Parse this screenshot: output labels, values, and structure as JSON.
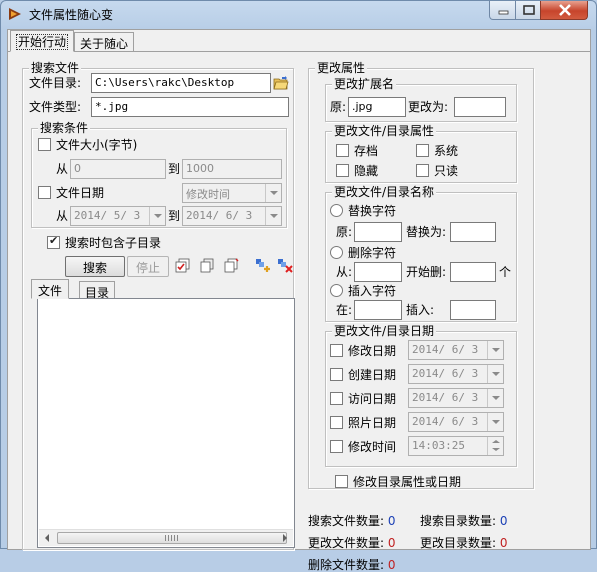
{
  "window": {
    "title": "文件属性随心变"
  },
  "tabs": [
    "开始行动",
    "关于随心"
  ],
  "search": {
    "group_title": "搜索文件",
    "dir_label": "文件目录:",
    "dir_value": "C:\\Users\\rakc\\Desktop",
    "type_label": "文件类型:",
    "type_value": "*.jpg",
    "conditions": {
      "title": "搜索条件",
      "size_label": "文件大小(字节)",
      "size_checked": false,
      "from_label": "从",
      "to_label": "到",
      "size_from": "0",
      "size_to": "1000",
      "date_label": "文件日期",
      "date_checked": false,
      "date_type": "修改时间",
      "date_from": "2014/ 5/ 3",
      "date_to": "2014/ 6/ 3"
    },
    "subdir_label": "搜索时包含子目录",
    "subdir_checked": true,
    "search_button": "搜索",
    "stop_button": "停止",
    "result_tabs": [
      "文件",
      "目录"
    ]
  },
  "change": {
    "group_title": "更改属性",
    "ext": {
      "title": "更改扩展名",
      "orig_label": "原:",
      "orig_value": ".jpg",
      "change_label": "更改为:",
      "change_value": ""
    },
    "attr": {
      "title": "更改文件/目录属性",
      "archive": "存档",
      "system": "系统",
      "hidden": "隐藏",
      "readonly": "只读"
    },
    "rename": {
      "title": "更改文件/目录名称",
      "replace_label": "替换字符",
      "orig_label": "原:",
      "replace_with_label": "替换为:",
      "delete_label": "删除字符",
      "from_label": "从:",
      "start_delete_label": "开始删:",
      "count_unit": "个",
      "insert_label": "插入字符",
      "at_label": "在:",
      "insert_text_label": "插入:"
    },
    "dates": {
      "title": "更改文件/目录日期",
      "modify_label": "修改日期",
      "modify_value": "2014/ 6/ 3",
      "create_label": "创建日期",
      "create_value": "2014/ 6/ 3",
      "access_label": "访问日期",
      "access_value": "2014/ 6/ 3",
      "photo_label": "照片日期",
      "photo_value": "2014/ 6/ 3",
      "time_label": "修改时间",
      "time_value": "14:03:25"
    },
    "dir_attr_label": "修改目录属性或日期"
  },
  "stats": {
    "search_files_label": "搜索文件数量:",
    "search_files": "0",
    "search_dirs_label": "搜索目录数量:",
    "search_dirs": "0",
    "changed_files_label": "更改文件数量:",
    "changed_files": "0",
    "changed_dirs_label": "更改目录数量:",
    "changed_dirs": "0",
    "deleted_files_label": "删除文件数量:",
    "deleted_files": "0"
  },
  "colors": {
    "stat_blue": "#1a3fb5",
    "stat_red": "#c02020"
  },
  "icons": [
    "app-icon",
    "minimize-icon",
    "maximize-icon",
    "close-icon",
    "folder-open-icon",
    "select-all-icon",
    "copy-icon",
    "paste-icon",
    "add-item-icon",
    "delete-item-icon"
  ]
}
